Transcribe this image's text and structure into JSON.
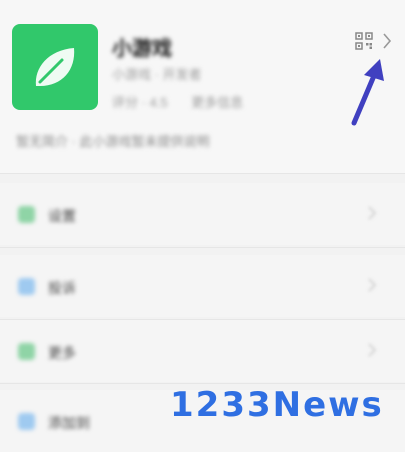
{
  "profile": {
    "name": "小游戏",
    "subtitle": "小游戏 · 开发者",
    "meta": [
      "评分 · 4.5",
      "更多信息"
    ],
    "status": "暂无简介 · 此小游戏暂未提供说明"
  },
  "menu_rows": [
    {
      "label": "设置",
      "icon_color": "#8fd4a6"
    },
    {
      "label": "投诉",
      "icon_color": "#9fcaf0"
    },
    {
      "label": "更多",
      "icon_color": "#8fd4a6"
    },
    {
      "label": "添加到",
      "icon_color": "#9fcaf0"
    }
  ],
  "icons": {
    "avatar": "leaf-icon",
    "qr": "qr-code-icon",
    "chevron": "chevron-right-icon",
    "annotation": "arrow-icon"
  },
  "colors": {
    "avatar_bg": "#31c86b",
    "arrow": "#4040c0",
    "watermark": "#2f6fe2"
  },
  "watermark": "1233News"
}
